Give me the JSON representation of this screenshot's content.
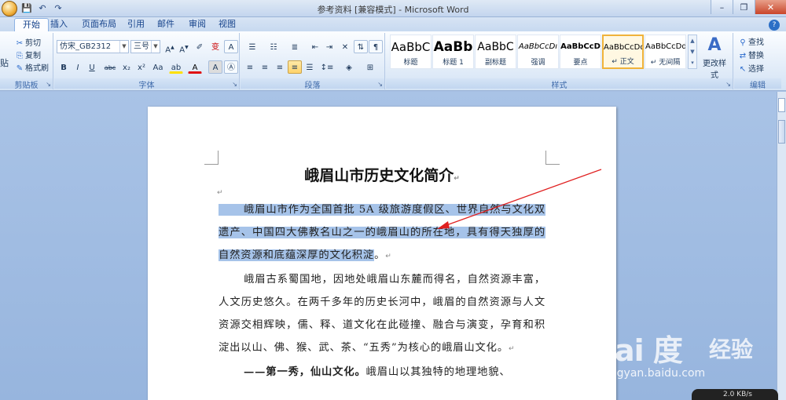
{
  "window": {
    "title": "参考资料 [兼容模式] - Microsoft Word",
    "qat_save": "💾",
    "qat_undo": "↶",
    "qat_redo": "↷"
  },
  "tabs": [
    {
      "label": "开始"
    },
    {
      "label": "插入"
    },
    {
      "label": "页面布局"
    },
    {
      "label": "引用"
    },
    {
      "label": "邮件"
    },
    {
      "label": "审阅"
    },
    {
      "label": "视图"
    }
  ],
  "ribbon": {
    "clipboard": {
      "paste": "贴",
      "cut": "剪切",
      "copy": "复制",
      "format_painter": "格式刷",
      "label": "剪贴板"
    },
    "font": {
      "name": "仿宋_GB2312",
      "size": "三号",
      "label": "字体"
    },
    "paragraph": {
      "label": "段落"
    },
    "styles": {
      "label": "样式",
      "items": [
        {
          "preview": "AaBbC",
          "name": "标题"
        },
        {
          "preview": "AaBb",
          "name": "标题 1"
        },
        {
          "preview": "AaBbC",
          "name": "副标题"
        },
        {
          "preview": "AaBbCcDı",
          "name": "强调"
        },
        {
          "preview": "AaBbCcD",
          "name": "要点"
        },
        {
          "preview": "AaBbCcDd",
          "name": "↵ 正文"
        },
        {
          "preview": "AaBbCcDd",
          "name": "↵ 无间隔"
        }
      ],
      "change_styles": "更改样式"
    },
    "editing": {
      "find": "查找",
      "replace": "替换",
      "select": "选择",
      "label": "编辑"
    }
  },
  "document": {
    "title": "峨眉山市历史文化简介",
    "para_mark": "↵",
    "p1_highlight": "峨眉山市作为全国首批 5A 级旅游度假区、世界自然与文化双遗产、中国四大佛教名山之一的峨眉山的所在地，具有得天独厚的自然资源和底蕴深厚的文化积淀",
    "p1_tail": "。",
    "p2": "峨眉古系蜀国地，因地处峨眉山东麓而得名，自然资源丰富，人文历史悠久。在两千多年的历史长河中，峨眉的自然资源与人文资源交相辉映，儒、释、道文化在此碰撞、融合与演变，孕育和积淀出以山、佛、猴、武、茶、“五秀”为核心的峨眉山文化。",
    "p3_bold": "——第一秀，仙山文化。",
    "p3": "峨眉山以其独特的地理地貌、"
  },
  "watermark": {
    "logo": "Bai 度",
    "jingyan": "经验",
    "url": "jingyan.baidu.com"
  },
  "status": {
    "speed": "2.0 KB/s"
  }
}
